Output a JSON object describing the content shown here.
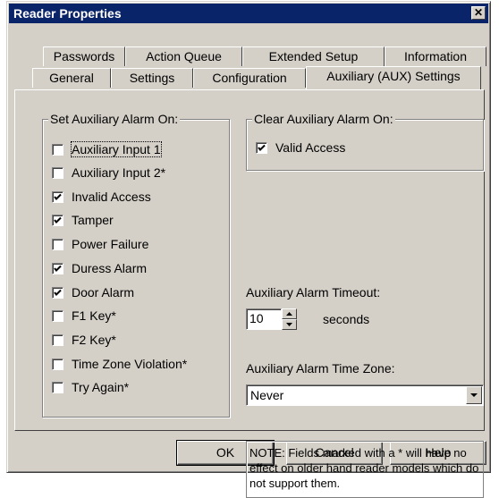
{
  "stray_text": "o",
  "window": {
    "title": "Reader Properties",
    "close_glyph": "✕"
  },
  "tabs_back": [
    "Passwords",
    "Action Queue",
    "Extended Setup",
    "Information"
  ],
  "tabs_front": [
    "General",
    "Settings",
    "Configuration",
    "Auxiliary (AUX) Settings"
  ],
  "active_tab": "Auxiliary (AUX) Settings",
  "set_alarm": {
    "title": "Set Auxiliary Alarm On:",
    "items": [
      {
        "label": "Auxiliary Input 1",
        "checked": false
      },
      {
        "label": "Auxiliary Input 2*",
        "checked": false
      },
      {
        "label": "Invalid Access",
        "checked": true
      },
      {
        "label": "Tamper",
        "checked": true
      },
      {
        "label": "Power Failure",
        "checked": false
      },
      {
        "label": "Duress Alarm",
        "checked": true
      },
      {
        "label": "Door Alarm",
        "checked": true
      },
      {
        "label": "F1 Key*",
        "checked": false
      },
      {
        "label": "F2 Key*",
        "checked": false
      },
      {
        "label": "Time Zone Violation*",
        "checked": false
      },
      {
        "label": "Try Again*",
        "checked": false
      }
    ]
  },
  "clear_alarm": {
    "title": "Clear Auxiliary Alarm On:",
    "valid_access_label": "Valid Access",
    "valid_access_checked": true
  },
  "timeout": {
    "label": "Auxiliary Alarm Timeout:",
    "value": "10",
    "unit": "seconds"
  },
  "time_zone": {
    "label": "Auxiliary Alarm Time Zone:",
    "value": "Never"
  },
  "note": "NOTE: Fields marked with a * will have no effect on older hand reader models which do not support them.",
  "buttons": {
    "ok": "OK",
    "cancel": "Cancel",
    "help": "Help"
  }
}
